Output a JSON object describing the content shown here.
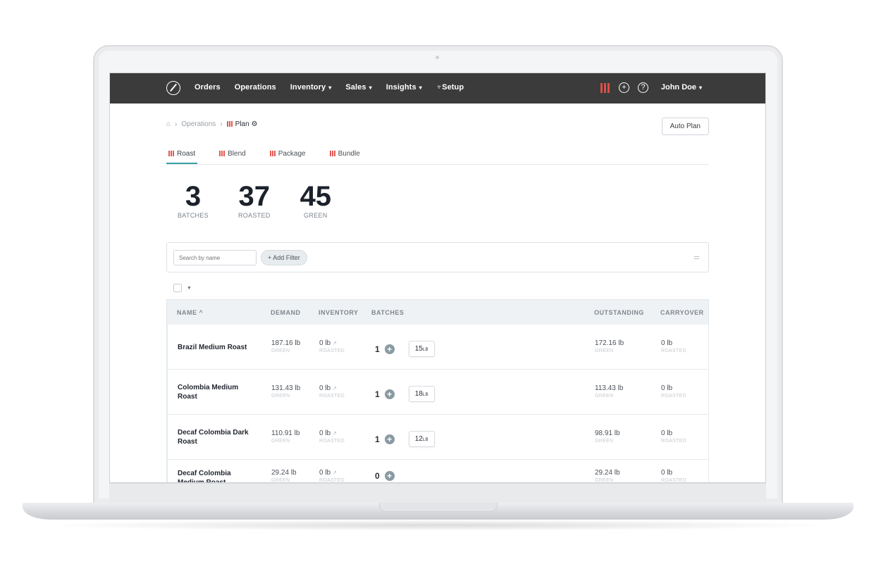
{
  "nav": {
    "items": [
      {
        "label": "Orders",
        "caret": false
      },
      {
        "label": "Operations",
        "caret": false
      },
      {
        "label": "Inventory",
        "caret": true
      },
      {
        "label": "Sales",
        "caret": true
      },
      {
        "label": "Insights",
        "caret": true
      },
      {
        "label": "Setup",
        "caret": false,
        "icon": "trophy-icon"
      }
    ],
    "user": "John Doe",
    "icons": [
      "plan-icon",
      "add-circle-icon",
      "help-circle-icon"
    ],
    "accent": "#e8534a"
  },
  "breadcrumb": {
    "home_icon": "home-icon",
    "parent": "Operations",
    "current": "Plan"
  },
  "actions": {
    "auto_plan": "Auto Plan"
  },
  "tabs": [
    {
      "label": "Roast",
      "active": true
    },
    {
      "label": "Blend",
      "active": false
    },
    {
      "label": "Package",
      "active": false
    },
    {
      "label": "Bundle",
      "active": false
    }
  ],
  "stats": [
    {
      "value": "3",
      "label": "BATCHES"
    },
    {
      "value": "37",
      "label": "ROASTED"
    },
    {
      "value": "45",
      "label": "GREEN"
    }
  ],
  "filters": {
    "search_placeholder": "Search by name",
    "add_filter": "+ Add Filter"
  },
  "table": {
    "headers": {
      "name": "NAME",
      "demand": "DEMAND",
      "inventory": "INVENTORY",
      "batches": "BATCHES",
      "outstanding": "OUTSTANDING",
      "carryover": "CARRYOVER"
    },
    "sort_indicator": "^",
    "sub_labels": {
      "green": "GREEN",
      "roasted": "ROASTED"
    },
    "rows": [
      {
        "name": "Brazil Medium Roast",
        "demand": "187.16 lb",
        "inventory": "0 lb",
        "batches": "1",
        "batch_size": "15",
        "batch_unit": "LB",
        "outstanding": "172.16 lb",
        "carryover": "0 lb"
      },
      {
        "name": "Colombia Medium Roast",
        "demand": "131.43 lb",
        "inventory": "0 lb",
        "batches": "1",
        "batch_size": "18",
        "batch_unit": "LB",
        "outstanding": "113.43 lb",
        "carryover": "0 lb"
      },
      {
        "name": "Decaf Colombia Dark Roast",
        "demand": "110.91 lb",
        "inventory": "0 lb",
        "batches": "1",
        "batch_size": "12",
        "batch_unit": "LB",
        "outstanding": "98.91 lb",
        "carryover": "0 lb"
      },
      {
        "name": "Decaf Colombia Medium Roast",
        "demand": "29.24 lb",
        "inventory": "0 lb",
        "batches": "0",
        "batch_size": "",
        "batch_unit": "",
        "outstanding": "29.24 lb",
        "carryover": "0 lb"
      }
    ]
  }
}
